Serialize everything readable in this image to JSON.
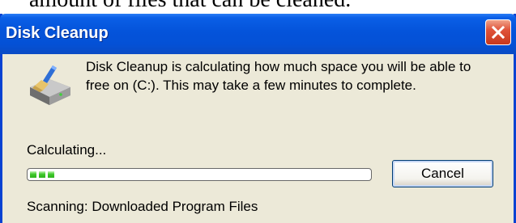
{
  "background_text": "amount of files that can be cleaned.",
  "window": {
    "title": "Disk Cleanup",
    "message": "Disk Cleanup is calculating how much space you will be able to free on  (C:). This may take a few minutes to complete.",
    "status_label": "Calculating...",
    "progress_fraction": 0.07,
    "cancel_label": "Cancel",
    "scanning_text": "Scanning:  Downloaded Program Files"
  },
  "icons": {
    "app": "disk-cleanup-icon",
    "close": "close-icon"
  },
  "colors": {
    "titlebar": "#0453da",
    "window_bg": "#ece9d8",
    "close_button": "#e0533a",
    "progress_fill": "#2db21a"
  }
}
